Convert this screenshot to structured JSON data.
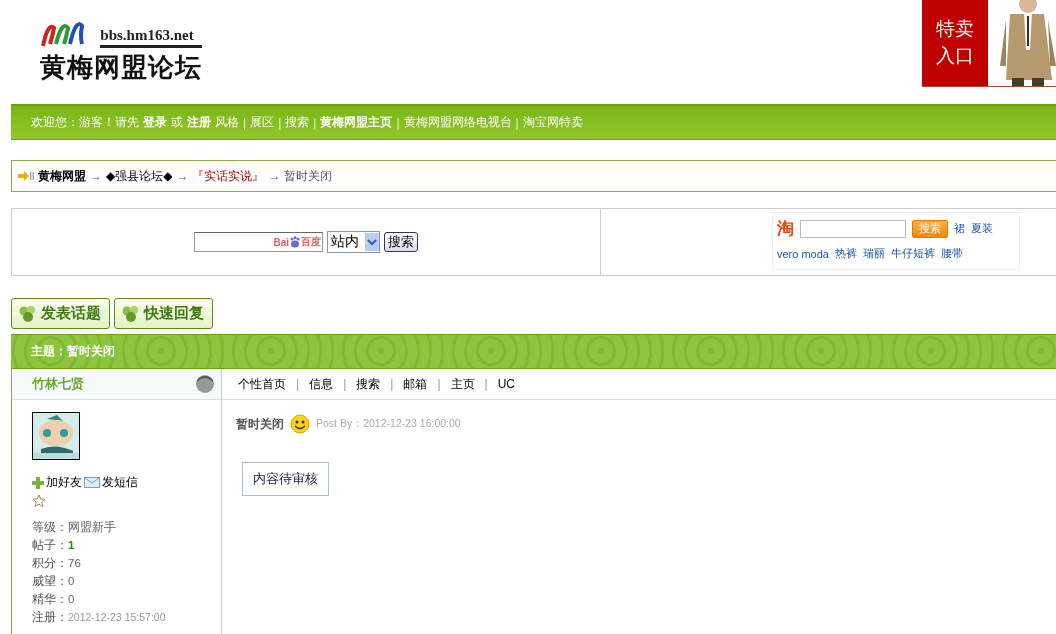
{
  "header": {
    "site_url": "bbs.hm163.net",
    "site_name": "黄梅网盟论坛",
    "ad": {
      "label_lines": [
        "特卖",
        "入口"
      ],
      "kind": "picture"
    }
  },
  "nav": {
    "items": [
      {
        "kind": "text",
        "text": "欢迎您：游客！请先"
      },
      {
        "kind": "link",
        "text": "登录",
        "bold": true
      },
      {
        "kind": "text",
        "text": "或"
      },
      {
        "kind": "link",
        "text": "注册",
        "bold": true
      },
      {
        "kind": "link",
        "text": "风格",
        "bold": false
      },
      {
        "kind": "separator",
        "text": "|"
      },
      {
        "kind": "link",
        "text": "展区",
        "bold": false
      },
      {
        "kind": "separator",
        "text": "|"
      },
      {
        "kind": "link",
        "text": "搜索",
        "bold": false
      },
      {
        "kind": "separator",
        "text": "|"
      },
      {
        "kind": "link",
        "text": "黄梅网盟主页",
        "bold": true
      },
      {
        "kind": "separator",
        "text": "|"
      },
      {
        "kind": "link",
        "text": "黄梅网盟网络电视台",
        "bold": false
      },
      {
        "kind": "separator",
        "text": "|"
      },
      {
        "kind": "link",
        "text": "淘宝网特卖",
        "bold": false
      }
    ]
  },
  "breadcrumb": [
    {
      "kind": "home",
      "text": "黄梅网盟"
    },
    {
      "kind": "arrow",
      "text": "→"
    },
    {
      "kind": "link",
      "text": "◆强县论坛◆"
    },
    {
      "kind": "arrow",
      "text": "→"
    },
    {
      "kind": "forum",
      "text": "『实话实说』"
    },
    {
      "kind": "arrow",
      "text": "→"
    },
    {
      "kind": "current",
      "text": "暂时关闭"
    }
  ],
  "site_search": {
    "logo_left": "Bai",
    "logo_right": "百度",
    "scope": "站内",
    "button": "搜索"
  },
  "taobao": {
    "logo": "淘",
    "button": "搜索",
    "links": [
      "裙",
      "夏装",
      "vero moda",
      "热裤",
      "瑞丽",
      "牛仔短裤",
      "腰带"
    ]
  },
  "actions": [
    "发表话题",
    "快速回复"
  ],
  "topic": {
    "title": "主题：暂时关闭"
  },
  "post": {
    "author": {
      "name": "竹林七贤",
      "online": false,
      "actions": [
        {
          "kind": "friend",
          "text": "加好友"
        },
        {
          "kind": "message",
          "text": "发短信"
        }
      ],
      "stats": [
        {
          "kind": "plain",
          "label": "等级：",
          "value": "网盟新手"
        },
        {
          "kind": "count",
          "label": "帖子：",
          "value": "1"
        },
        {
          "kind": "plain",
          "label": "积分：",
          "value": "76"
        },
        {
          "kind": "plain",
          "label": "威望：",
          "value": "0"
        },
        {
          "kind": "plain",
          "label": "精华：",
          "value": "0"
        },
        {
          "kind": "date",
          "label": "注册：",
          "value": "2012-12-23 15:57:00"
        }
      ]
    },
    "links": [
      {
        "kind": "link",
        "text": "个性首页"
      },
      {
        "kind": "separator",
        "text": "|"
      },
      {
        "kind": "link",
        "text": "信息"
      },
      {
        "kind": "separator",
        "text": "|"
      },
      {
        "kind": "link",
        "text": "搜索"
      },
      {
        "kind": "separator",
        "text": "|"
      },
      {
        "kind": "link",
        "text": "邮箱"
      },
      {
        "kind": "separator",
        "text": "|"
      },
      {
        "kind": "link",
        "text": "主页"
      },
      {
        "kind": "separator",
        "text": "|"
      },
      {
        "kind": "link",
        "text": "UC"
      }
    ],
    "title": "暂时关闭",
    "meta": "Post By：2012-12-23 16:00:00",
    "content": "内容待审核"
  }
}
